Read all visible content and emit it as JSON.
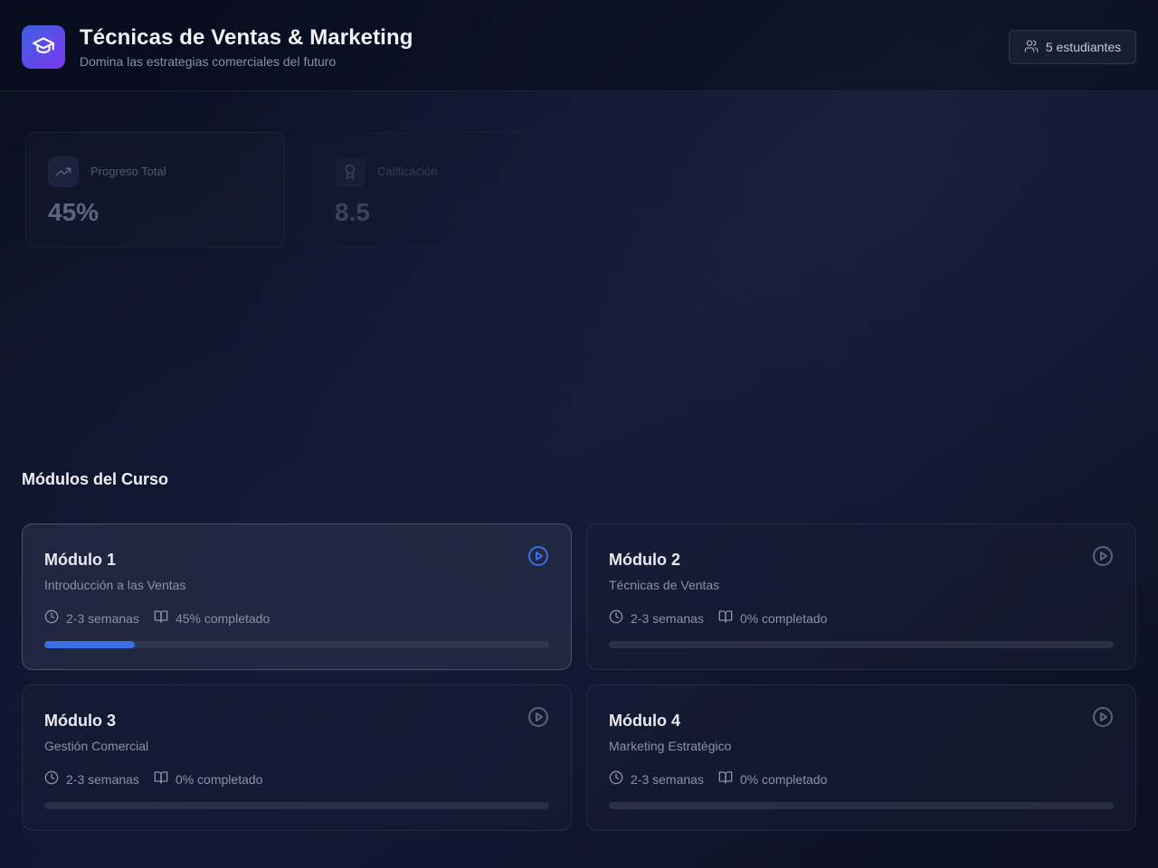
{
  "header": {
    "title": "Técnicas de Ventas & Marketing",
    "subtitle": "Domina las estrategias comerciales del futuro",
    "students_label": "5 estudiantes",
    "logo_icon": "graduation-cap-icon",
    "students_icon": "users-icon"
  },
  "stats": [
    {
      "label": "Progreso Total",
      "value": "45%",
      "icon": "trending-up-icon"
    },
    {
      "label": "Calificación",
      "value": "8.5",
      "icon": "award-icon"
    }
  ],
  "modules_section": {
    "title": "Módulos del Curso"
  },
  "modules": [
    {
      "title": "Módulo 1",
      "subtitle": "Introducción a las Ventas",
      "duration": "2-3 semanas",
      "progress_label": "45% completado",
      "progress": 0.18,
      "active": true
    },
    {
      "title": "Módulo 2",
      "subtitle": "Técnicas de Ventas",
      "duration": "2-3 semanas",
      "progress_label": "0% completado",
      "progress": 0,
      "active": false
    },
    {
      "title": "Módulo 3",
      "subtitle": "Gestión Comercial",
      "duration": "2-3 semanas",
      "progress_label": "0% completado",
      "progress": 0,
      "active": false
    },
    {
      "title": "Módulo 4",
      "subtitle": "Marketing Estratégico",
      "duration": "2-3 semanas",
      "progress_label": "0% completado",
      "progress": 0,
      "active": false
    }
  ],
  "colors": {
    "accent": "#3a6ee6",
    "logo_gradient_start": "#3b5fe0",
    "logo_gradient_end": "#7c3aed",
    "play_active": "#3a6ee6",
    "play_inactive": "#5c6378"
  }
}
